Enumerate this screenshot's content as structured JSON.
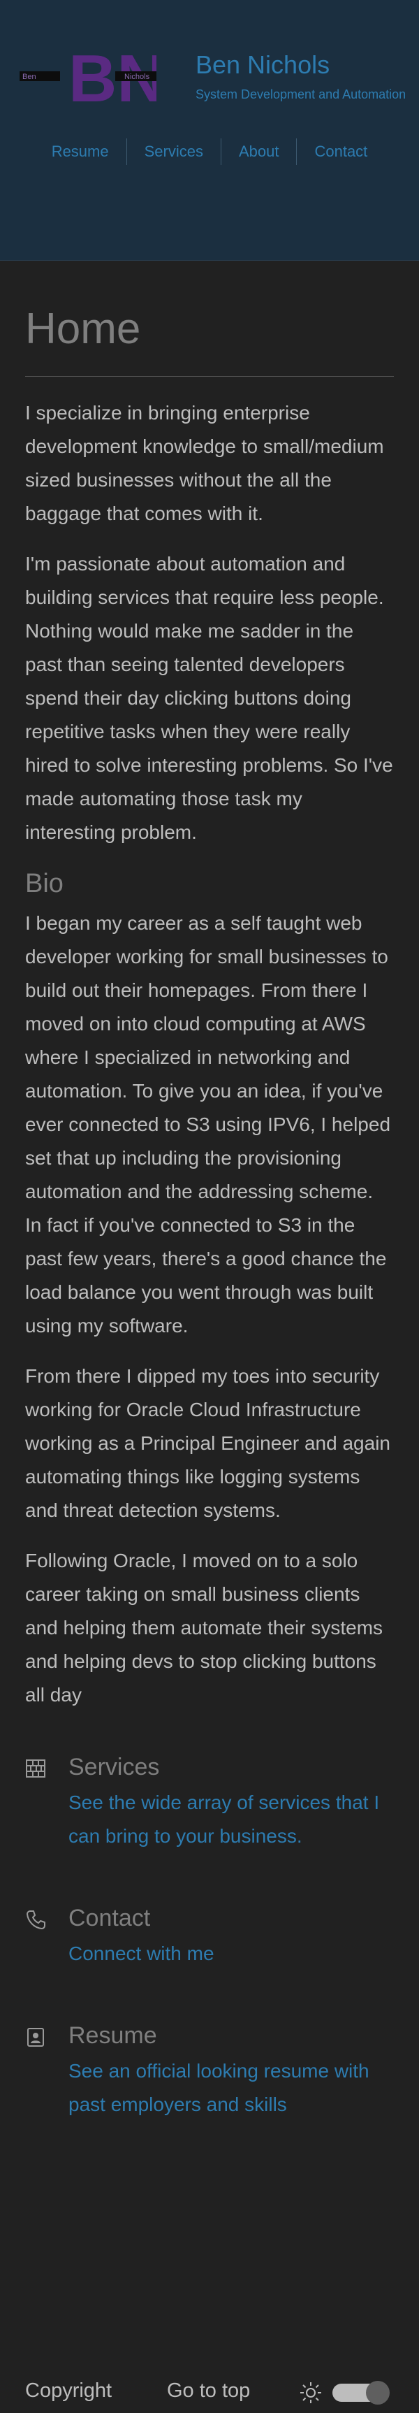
{
  "header": {
    "logo": {
      "monogram": "BN",
      "small_left": "Ben",
      "small_right": "Nichols"
    },
    "title": "Ben Nichols",
    "tagline": "System Development and Automation",
    "nav": [
      "Resume",
      "Services",
      "About",
      "Contact"
    ]
  },
  "main": {
    "title": "Home",
    "intro": [
      "I specialize in bringing enterprise development knowledge to small/medium sized businesses without the all the baggage that comes with it.",
      "I'm passionate about automation and building services that require less people. Nothing would make me sadder in the past than seeing talented developers spend their day clicking buttons doing repetitive tasks when they were really hired to solve interesting problems. So I've made automating those task my interesting problem."
    ],
    "bio_heading": "Bio",
    "bio": [
      "I began my career as a self taught web developer working for small businesses to build out their homepages. From there I moved on into cloud computing at AWS where I specialized in networking and automation. To give you an idea, if you've ever connected to S3 using IPV6, I helped set that up including the provisioning automation and the addressing scheme. In fact if you've connected to S3 in the past few years, there's a good chance the load balance you went through was built using my software.",
      "From there I dipped my toes into security working for Oracle Cloud Infrastructure working as a Principal Engineer and again automating things like logging systems and threat detection systems.",
      "Following Oracle, I moved on to a solo career taking on small business clients and helping them automate their systems and helping devs to stop clicking buttons all day"
    ],
    "links": {
      "services": {
        "icon": "services-grid-icon",
        "heading": "Services",
        "link": "See the wide array of services that I can bring to your business."
      },
      "contact": {
        "icon": "phone-icon",
        "heading": "Contact",
        "link": "Connect with me"
      },
      "resume": {
        "icon": "resume-badge-icon",
        "heading": "Resume",
        "link": "See an official looking resume with past employers and skills"
      }
    }
  },
  "footer": {
    "copyright": "Copyright",
    "go_top": "Go to top",
    "theme_icon": "sun-icon"
  },
  "colors": {
    "background": "#212121",
    "header_bg": "#1b2f40",
    "link": "#2d7cb0",
    "logo_purple": "#5a2a82"
  }
}
